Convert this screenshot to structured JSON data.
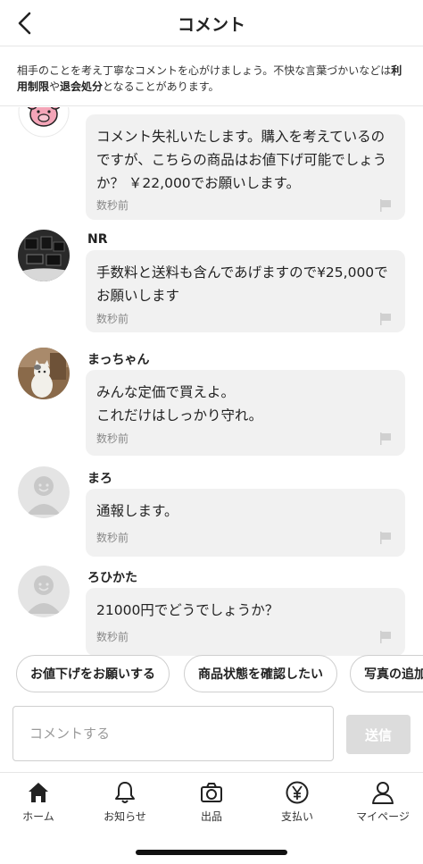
{
  "header": {
    "title": "コメント"
  },
  "notice": {
    "pre": "相手のことを考え丁寧なコメントを心がけましょう。不快な言葉づかいなどは",
    "bold1": "利用制限",
    "mid": "や",
    "bold2": "退会処分",
    "post": "となることがあります。"
  },
  "comments": [
    {
      "name": "",
      "text": "コメント失礼いたします。購入を考えているのですが、こちらの商品はお値下げ可能でしょうか？ ￥22,000でお願いします。",
      "time": "数秒前",
      "avatar": "pink-character-icon"
    },
    {
      "name": "NR",
      "text": "手数料と送料も含んであげますので¥25,000でお願いします",
      "time": "数秒前",
      "avatar": "dark-photo"
    },
    {
      "name": "まっちゃん",
      "text": "みんな定価で買えよ。\nこれだけはしっかり守れ。",
      "time": "数秒前",
      "avatar": "cat-photo"
    },
    {
      "name": "まろ",
      "text": "通報します。",
      "time": "数秒前",
      "avatar": "default-face-icon"
    },
    {
      "name": "ろひかた",
      "text": "21000円でどうでしょうか？",
      "time": "数秒前",
      "avatar": "default-face-icon"
    }
  ],
  "quick_replies": [
    "お値下げをお願いする",
    "商品状態を確認したい",
    "写真の追加"
  ],
  "input": {
    "placeholder": "コメントする",
    "send_label": "送信"
  },
  "tabbar": [
    {
      "label": "ホーム",
      "icon": "home-icon"
    },
    {
      "label": "お知らせ",
      "icon": "bell-icon"
    },
    {
      "label": "出品",
      "icon": "camera-icon"
    },
    {
      "label": "支払い",
      "icon": "yen-icon"
    },
    {
      "label": "マイページ",
      "icon": "person-icon"
    }
  ],
  "colors": {
    "bubble": "#f1f1f1",
    "send_disabled": "#dcdcdc",
    "text": "#222222",
    "muted": "#888888"
  }
}
